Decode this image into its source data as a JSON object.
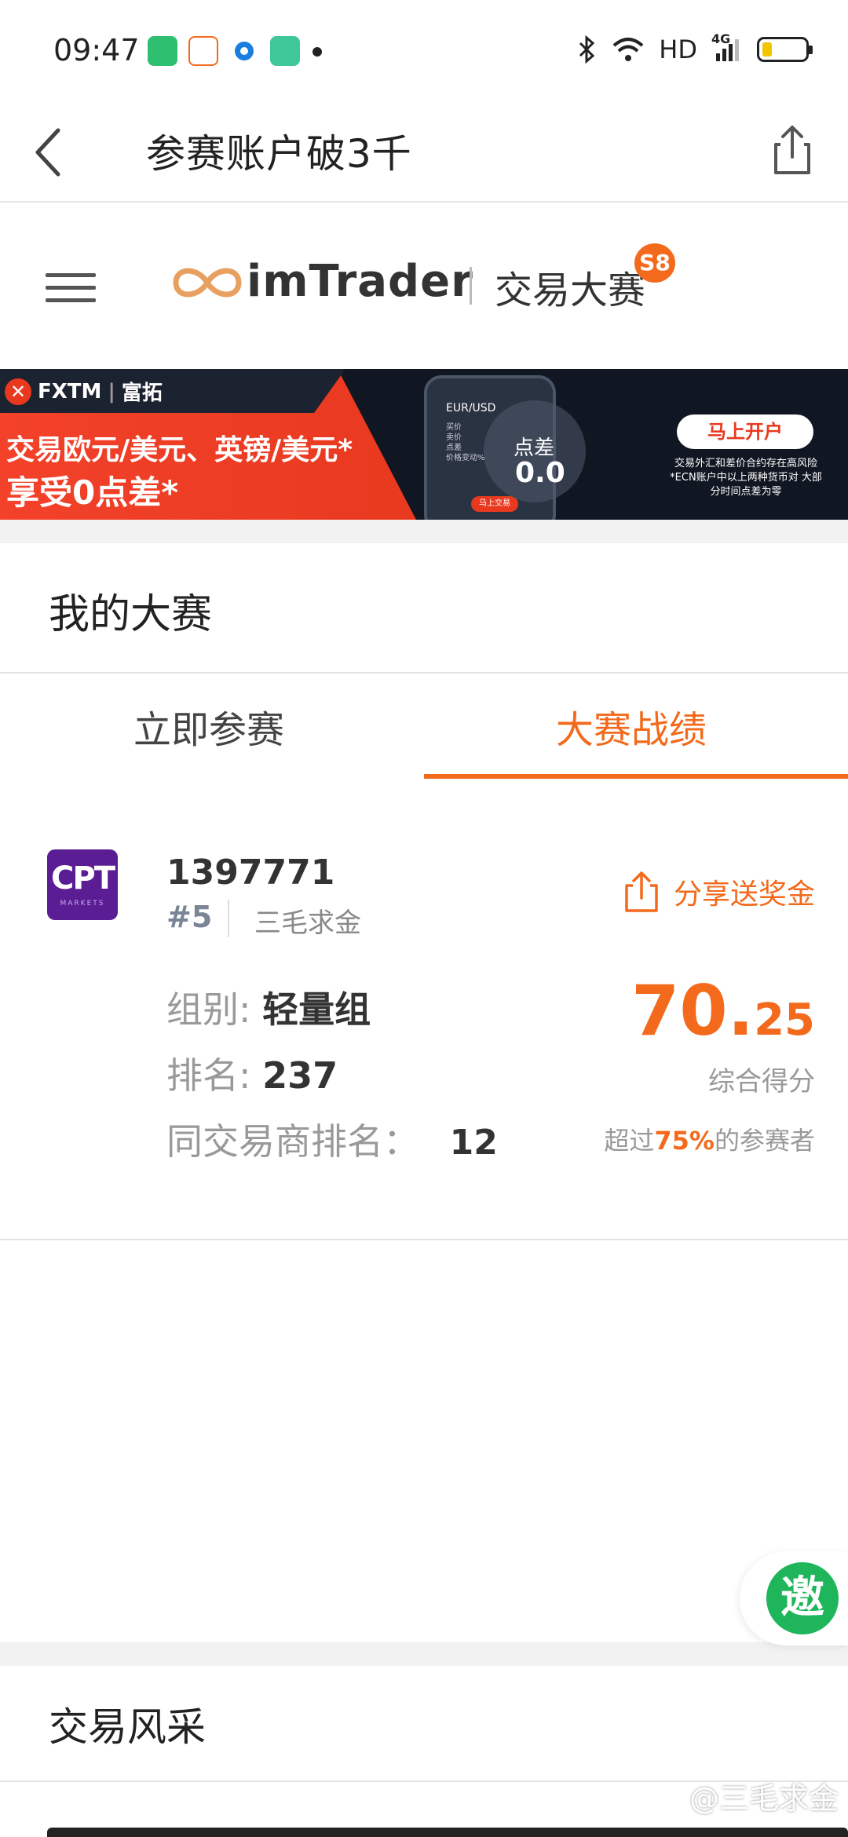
{
  "status_bar": {
    "time": "09:47",
    "network": "HD",
    "signal": "4G"
  },
  "title_bar": {
    "title": "参赛账户破3千"
  },
  "brand": {
    "logo_text": "imTrader",
    "subtitle": "交易大赛",
    "season": "S8"
  },
  "banner": {
    "logo": "FXTM",
    "logo_cn": "富拓",
    "line1": "交易欧元/美元、英镑/美元*",
    "line2": "享受0点差*",
    "pair": "EUR/USD",
    "rows": [
      "买价",
      "卖价",
      "点差",
      "价格变动%"
    ],
    "phone_button": "马上交易",
    "spread_label": "点差",
    "spread_value": "0.0",
    "cta": "马上开户",
    "risk": "交易外汇和差价合约存在高风险 *ECN账户中以上两种货币对 大部分时间点差为零"
  },
  "my_contest": {
    "title": "我的大赛",
    "tabs": [
      {
        "label": "立即参赛",
        "active": false
      },
      {
        "label": "大赛战绩",
        "active": true
      }
    ]
  },
  "record": {
    "broker_logo": "CPT",
    "broker_logo_sub": "MARKETS",
    "account": "1397771",
    "number": "#5",
    "nickname": "三毛求金",
    "share_label": "分享送奖金",
    "group_label": "组别:",
    "group_value": "轻量组",
    "rank_label": "排名:",
    "rank_value": "237",
    "broker_rank_label": "同交易商排名：",
    "broker_rank_value": "12",
    "score_int": "70.",
    "score_dec": "25",
    "score_label": "综合得分",
    "exceed_prefix": "超过",
    "exceed_pct": "75%",
    "exceed_suffix": "的参赛者"
  },
  "invite": {
    "label": "邀"
  },
  "trade_style": {
    "title": "交易风采"
  },
  "watermark": "@三毛求金",
  "colors": {
    "accent": "#f36a1d",
    "invite": "#1fb55a",
    "banner_red": "#e8391f",
    "broker_purple": "#5a1d93"
  }
}
